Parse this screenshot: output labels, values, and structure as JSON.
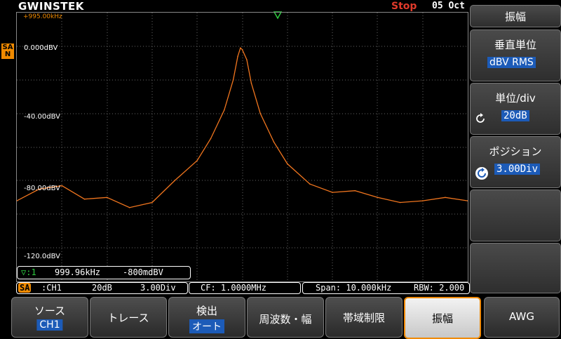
{
  "header": {
    "logo": "GWINSTEK",
    "run_status": "Stop",
    "date": "05 Oct"
  },
  "channel_tag": "SA N",
  "graticule": {
    "start_freq": "+995.00kHz",
    "ref_labels": [
      "0.000dBV",
      "-40.00dBV",
      "-80.00dBV",
      "-120.0dBV"
    ]
  },
  "marker": {
    "id": "▽:1",
    "freq": "999.96kHz",
    "level": "-800mdBV"
  },
  "status_bar": {
    "source_badge": "SA",
    "channel": ":CH1",
    "scale": "20dB",
    "position": "3.00Div",
    "center_freq": "CF: 1.0000MHz",
    "span": "Span: 10.000kHz",
    "rbw": "RBW: 2.000"
  },
  "side_menu": {
    "title": "振幅",
    "items": [
      {
        "label": "垂直単位",
        "value": "dBV RMS"
      },
      {
        "label": "単位/div",
        "value": "20dB"
      },
      {
        "label": "ポジション",
        "value": "3.00Div"
      }
    ]
  },
  "bottom_menu": {
    "buttons": [
      {
        "label": "ソース",
        "value": "CH1"
      },
      {
        "label": "トレース",
        "value": ""
      },
      {
        "label": "検出",
        "value": "オート"
      },
      {
        "label": "周波数・幅",
        "value": ""
      },
      {
        "label": "帯域制限",
        "value": ""
      },
      {
        "label": "振幅",
        "value": ""
      },
      {
        "label": "AWG",
        "value": ""
      }
    ]
  },
  "colors": {
    "trace": "#f0751e",
    "accent": "#f08a00",
    "value_bg": "#1c5bb8",
    "stop": "#e03a2a"
  },
  "chart_data": {
    "type": "line",
    "title": "",
    "xlabel": "",
    "ylabel": "",
    "x_range_kHz": [
      995.0,
      1005.0
    ],
    "ylim_dBV": [
      -140,
      20
    ],
    "grid": true,
    "series": [
      {
        "name": "",
        "x": [
          995.0,
          995.5,
          996.0,
          996.5,
          997.0,
          997.5,
          998.0,
          998.5,
          999.0,
          999.3,
          999.6,
          999.8,
          999.9,
          999.96,
          1000.0,
          1000.1,
          1000.2,
          1000.4,
          1000.7,
          1001.0,
          1001.5,
          1002.0,
          1002.5,
          1003.0,
          1003.5,
          1004.0,
          1004.5,
          1005.0
        ],
        "y": [
          -92,
          -85,
          -83,
          -91,
          -90,
          -96,
          -93,
          -80,
          -68,
          -55,
          -38,
          -20,
          -6,
          -1,
          -2,
          -8,
          -22,
          -40,
          -57,
          -70,
          -82,
          -87,
          -86,
          -90,
          -93,
          -92,
          -90,
          -92
        ]
      }
    ]
  }
}
